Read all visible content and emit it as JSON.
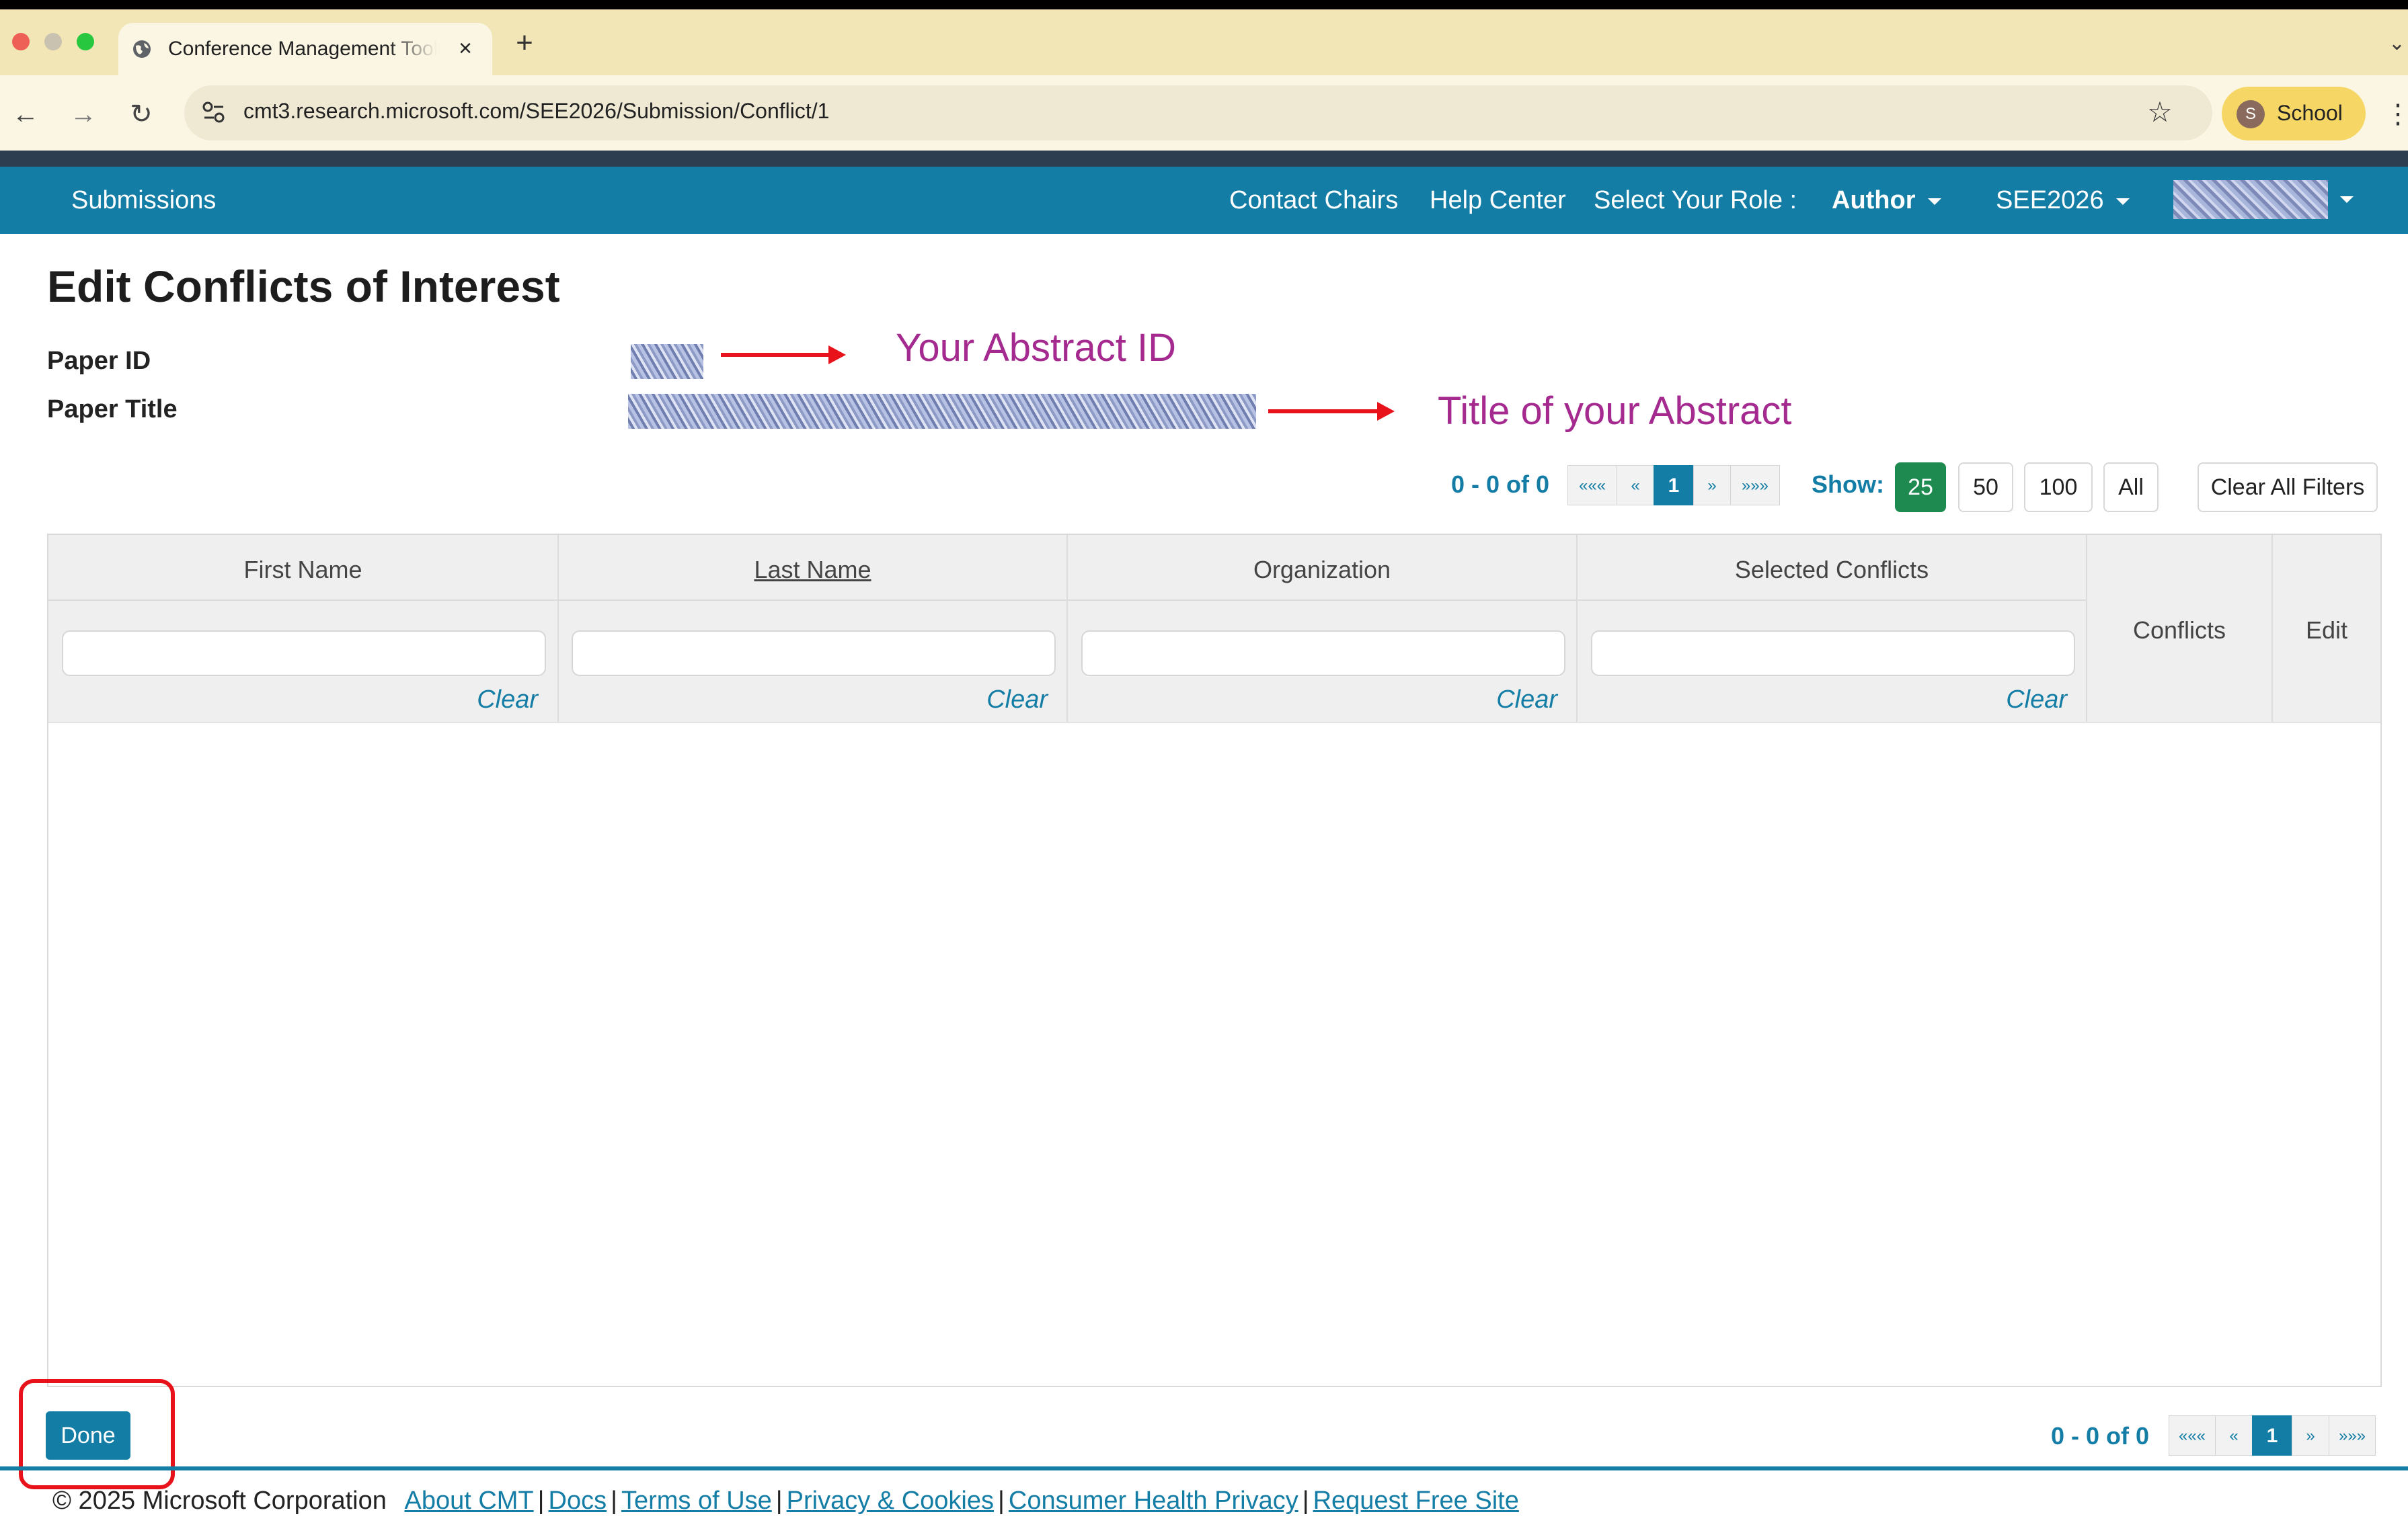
{
  "browser": {
    "tab_title": "Conference Management Tool",
    "tab_close": "×",
    "new_tab": "+",
    "url": "cmt3.research.microsoft.com/SEE2026/Submission/Conflict/1",
    "profile_initial": "S",
    "profile_label": "School",
    "colors": {
      "tabbar": "#f3e6b6",
      "toolbar": "#fbf6e4",
      "profile": "#f6d766"
    },
    "icons": [
      "globe-icon",
      "back-icon",
      "forward-icon",
      "reload-icon",
      "site-settings-icon",
      "bookmark-star-icon",
      "menu-kebab-icon",
      "tab-search-icon"
    ]
  },
  "navbar": {
    "brand": "Submissions",
    "contact": "Contact Chairs",
    "help": "Help Center",
    "role_label": "Select Your Role :",
    "role_value": "Author",
    "conference": "SEE2026",
    "color": "#137da5"
  },
  "page": {
    "title": "Edit Conflicts of Interest",
    "paper_id_label": "Paper ID",
    "paper_title_label": "Paper Title"
  },
  "annotations": {
    "abstract_id": "Your Abstract ID",
    "abstract_title": "Title of your Abstract",
    "color": "#a52a8f",
    "arrow_color": "#e8121a"
  },
  "pagination": {
    "range": "0 - 0 of 0",
    "first": "«««",
    "prev": "«",
    "current": "1",
    "next": "»",
    "last": "»»»"
  },
  "page_size": {
    "label": "Show:",
    "options": [
      "25",
      "50",
      "100",
      "All"
    ],
    "selected": "25"
  },
  "clear_all_filters": "Clear All Filters",
  "table": {
    "columns": [
      "First Name",
      "Last Name",
      "Organization",
      "Selected Conflicts",
      "Conflicts",
      "Edit"
    ],
    "sorted_column": "Last Name",
    "filter_clear": "Clear",
    "rows": []
  },
  "actions": {
    "done": "Done"
  },
  "footer": {
    "copyright": "© 2025 Microsoft Corporation",
    "links": [
      "About CMT",
      "Docs",
      "Terms of Use",
      "Privacy & Cookies",
      "Consumer Health Privacy",
      "Request Free Site"
    ]
  }
}
